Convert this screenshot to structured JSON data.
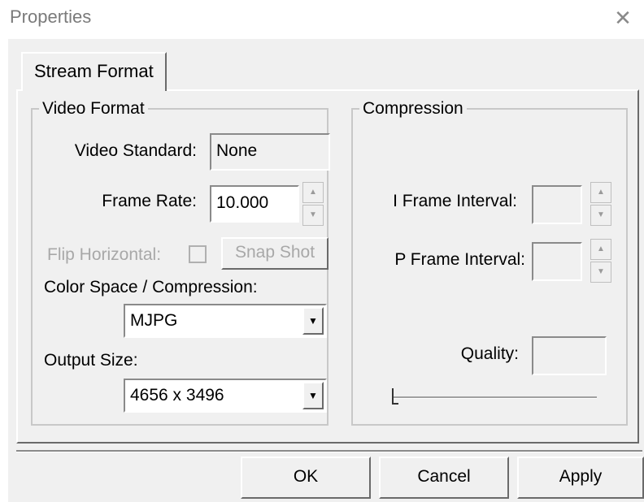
{
  "window": {
    "title": "Properties",
    "close_icon": "close-icon"
  },
  "tabs": [
    {
      "label": "Stream Format",
      "selected": true
    }
  ],
  "video_format": {
    "legend": "Video Format",
    "video_standard_label": "Video Standard:",
    "video_standard_value": "None",
    "frame_rate_label": "Frame Rate:",
    "frame_rate_value": "10.000",
    "flip_horizontal_label": "Flip Horizontal:",
    "flip_horizontal_checked": false,
    "snap_shot_label": "Snap Shot",
    "color_space_label": "Color Space / Compression:",
    "color_space_value": "MJPG",
    "output_size_label": "Output Size:",
    "output_size_value": "4656 x 3496"
  },
  "compression": {
    "legend": "Compression",
    "i_frame_label": "I Frame Interval:",
    "i_frame_value": "",
    "p_frame_label": "P Frame Interval:",
    "p_frame_value": "",
    "quality_label": "Quality:",
    "quality_value": "",
    "quality_slider_position": 0
  },
  "footer": {
    "ok_label": "OK",
    "cancel_label": "Cancel",
    "apply_label": "Apply"
  },
  "icons": {
    "spin_up": "chevron-up-icon",
    "spin_down": "chevron-down-icon",
    "dropdown": "dropdown-arrow-icon"
  }
}
